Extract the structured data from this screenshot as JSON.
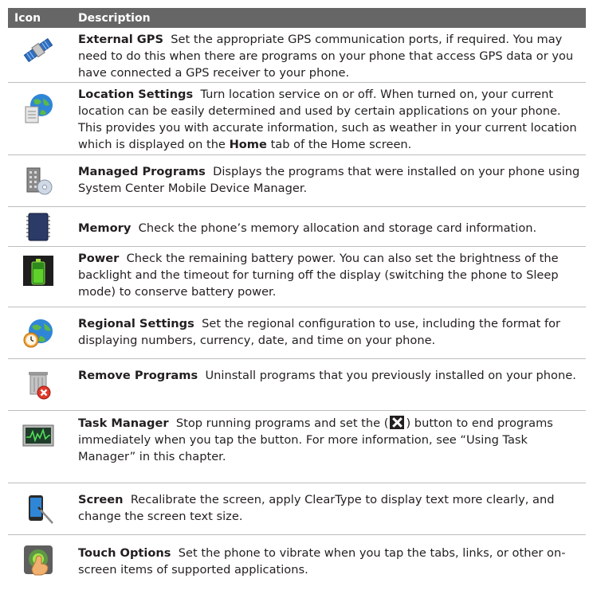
{
  "header": {
    "col_icon": "Icon",
    "col_description": "Description"
  },
  "rows": [
    {
      "title": "External GPS",
      "text": "Set the appropriate GPS communication ports, if required. You may need to do this when there are programs on your phone that access GPS data or you have connected a GPS receiver to your phone.",
      "icon": "satellite-icon"
    },
    {
      "title": "Location Settings",
      "text_before": "Turn location service on or off. When turned on, your current location can be easily determined and used by certain applications on your phone. This provides you with accurate information, such as weather in your current location which is displayed on the",
      "bold_word": "Home",
      "text_after": "tab of the Home screen.",
      "icon": "globe-document-icon"
    },
    {
      "title": "Managed Programs",
      "text": "Displays the programs that were installed on your phone using System Center Mobile Device Manager.",
      "icon": "building-disc-icon"
    },
    {
      "title": "Memory",
      "text": "Check the phone’s memory allocation and storage card information.",
      "icon": "memory-chip-icon"
    },
    {
      "title": "Power",
      "text": "Check the remaining battery power. You can also set the brightness of the backlight and the timeout for turning off the display (switching the phone to Sleep mode) to conserve battery power.",
      "icon": "battery-icon"
    },
    {
      "title": "Regional Settings",
      "text": "Set the regional configuration to use, including the format for displaying numbers, currency, date, and time on your phone.",
      "icon": "globe-clock-icon"
    },
    {
      "title": "Remove Programs",
      "text": "Uninstall programs that you previously installed on your phone.",
      "icon": "trash-remove-icon"
    },
    {
      "title": "Task Manager",
      "text_before": "Stop running programs and set the (",
      "text_after": ") button to end programs immediately when you tap the button. For more information, see “Using Task Manager” in this chapter.",
      "icon": "task-monitor-icon",
      "inline_icon": "close-x-icon"
    },
    {
      "title": "Screen",
      "text": "Recalibrate the screen, apply ClearType to display text more clearly, and change the screen text size.",
      "icon": "phone-stylus-icon"
    },
    {
      "title": "Touch Options",
      "text": "Set the phone to vibrate when you tap the tabs, links, or other on-screen items of supported applications.",
      "icon": "finger-touch-icon"
    }
  ]
}
